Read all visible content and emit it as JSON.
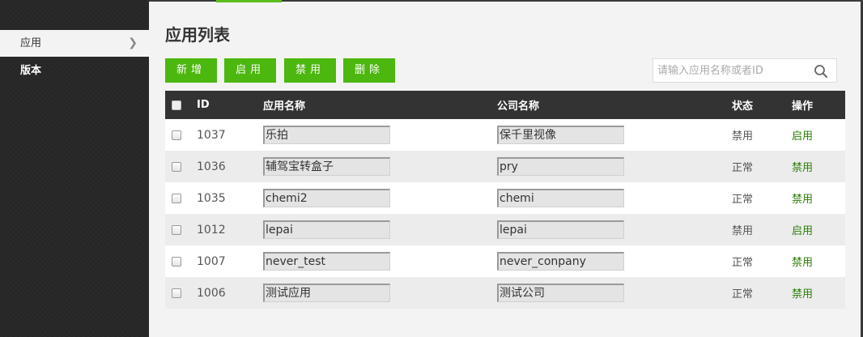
{
  "sidebar": {
    "items": [
      {
        "label": "应用",
        "active": true
      },
      {
        "label": "版本",
        "active": false
      }
    ]
  },
  "page": {
    "title": "应用列表"
  },
  "toolbar": {
    "buttons": [
      "新增",
      "启用",
      "禁用",
      "删除"
    ],
    "search_placeholder": "请输入应用名称或者ID"
  },
  "table": {
    "headers": {
      "id": "ID",
      "app_name": "应用名称",
      "company": "公司名称",
      "status": "状态",
      "operation": "操作"
    },
    "rows": [
      {
        "id": "1037",
        "app_name": "乐拍",
        "company": "保千里视像",
        "status": "禁用",
        "operation": "启用"
      },
      {
        "id": "1036",
        "app_name": "辅驾宝转盒子",
        "company": "pry",
        "status": "正常",
        "operation": "禁用"
      },
      {
        "id": "1035",
        "app_name": "chemi2",
        "company": "chemi",
        "status": "正常",
        "operation": "禁用"
      },
      {
        "id": "1012",
        "app_name": "lepai",
        "company": "lepai",
        "status": "禁用",
        "operation": "启用"
      },
      {
        "id": "1007",
        "app_name": "never_test",
        "company": "never_conpany",
        "status": "正常",
        "operation": "禁用"
      },
      {
        "id": "1006",
        "app_name": "测试应用",
        "company": "测试公司",
        "status": "正常",
        "operation": "禁用"
      }
    ]
  },
  "colors": {
    "accent": "#4cb70e",
    "link": "#2c7d07",
    "header_bg": "#333333"
  }
}
